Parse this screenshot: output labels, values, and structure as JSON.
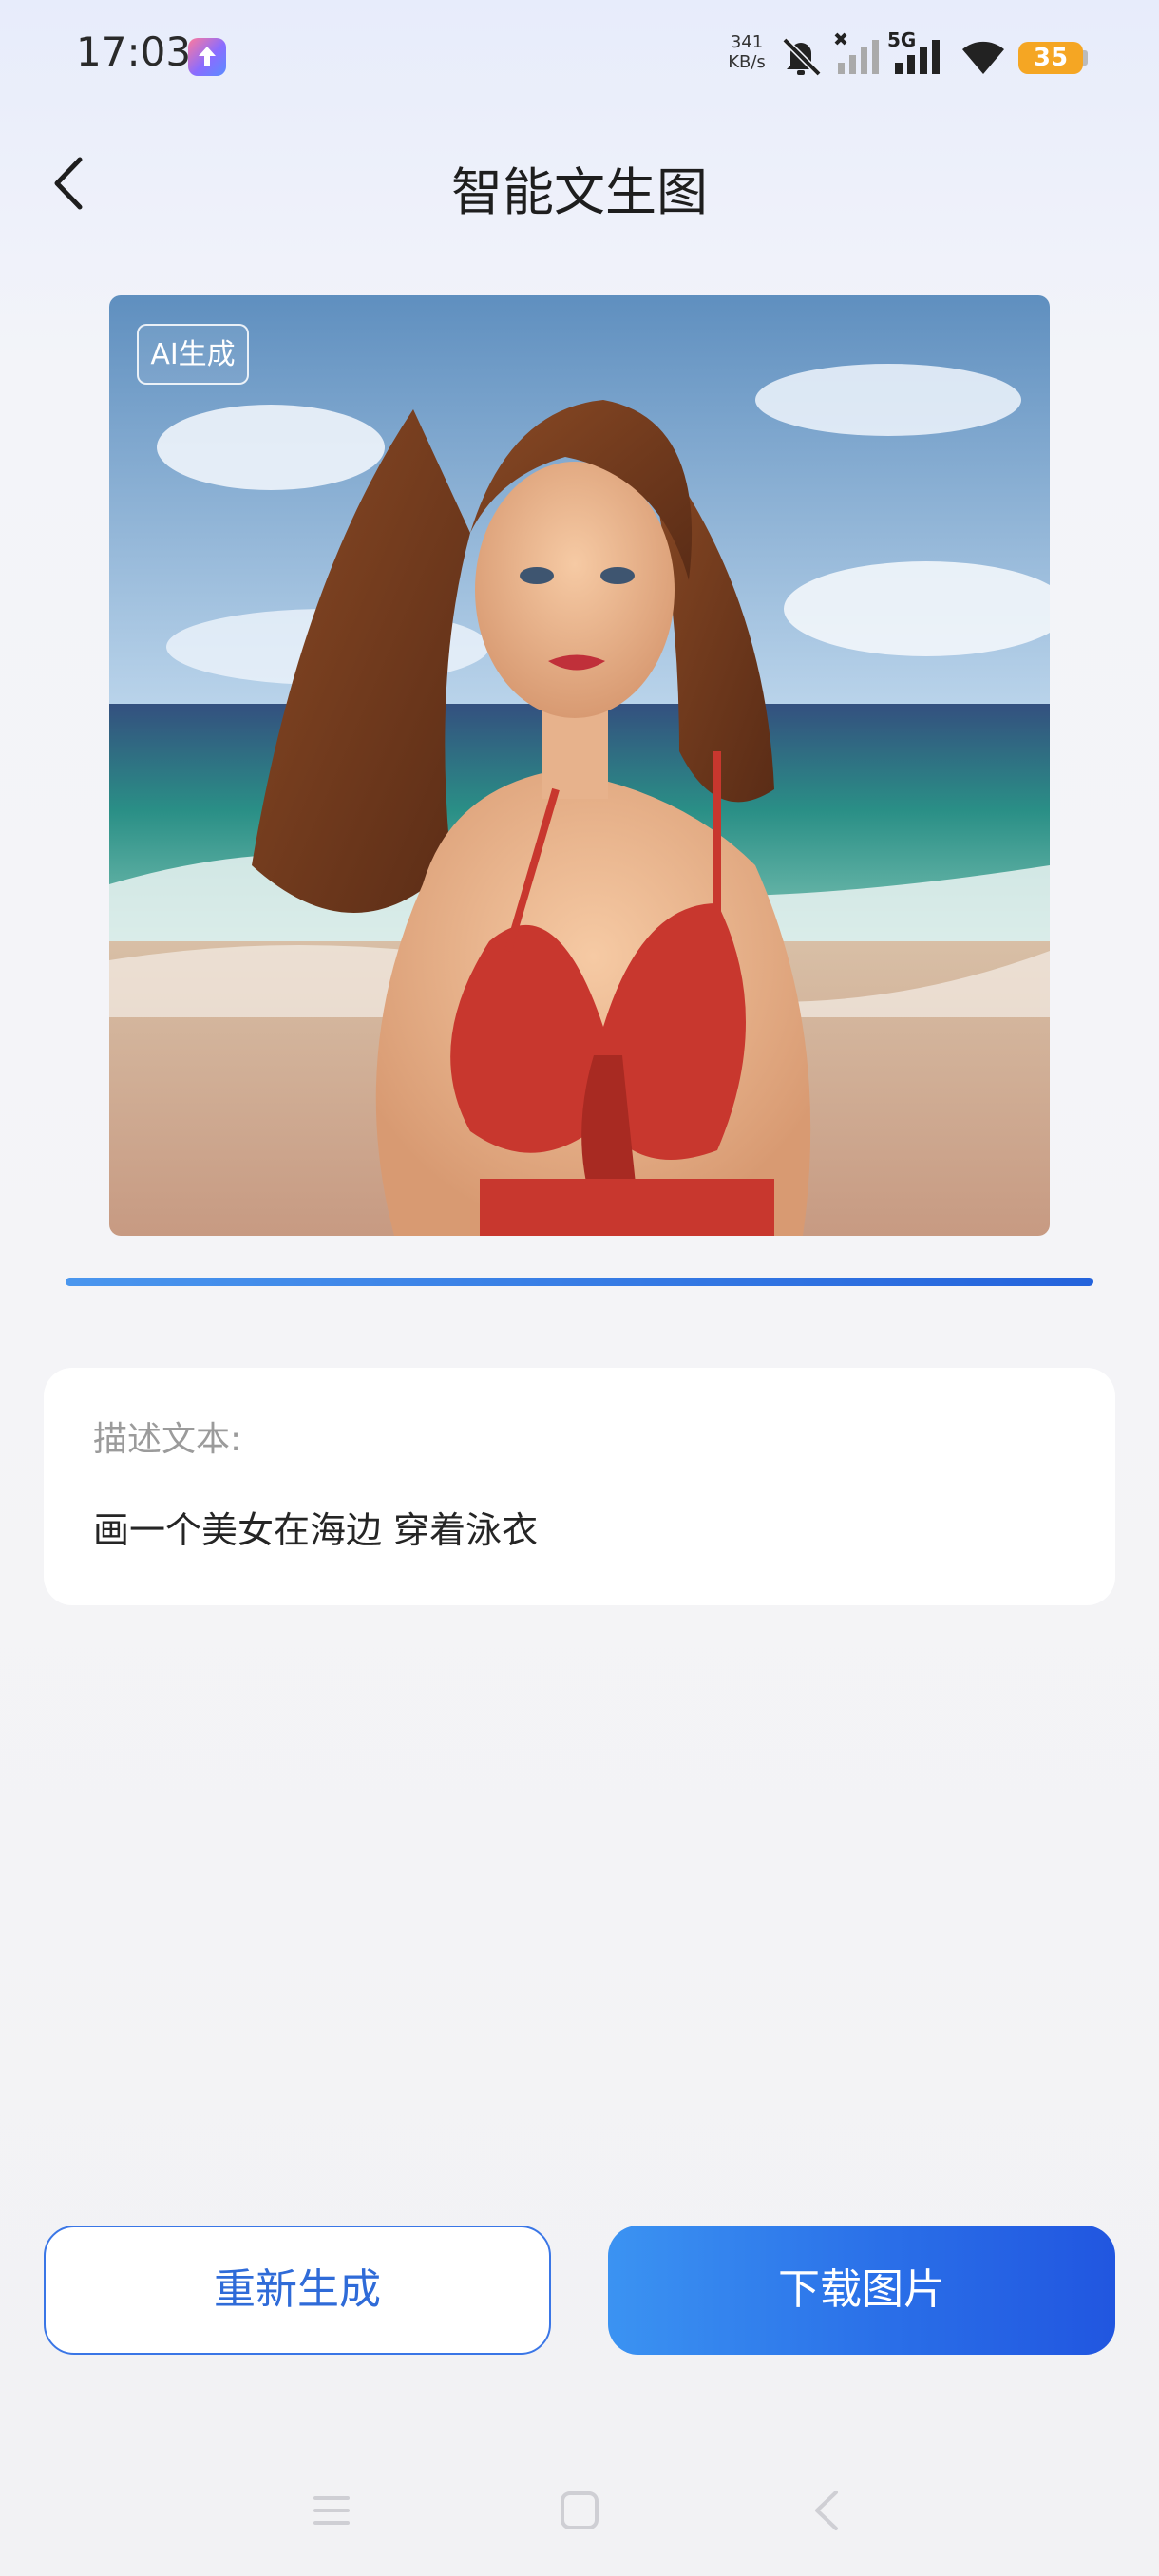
{
  "status_bar": {
    "time": "17:03",
    "net_speed_value": "341",
    "net_speed_unit": "KB/s",
    "network_type": "5G",
    "battery": "35",
    "icons": [
      "app-notification-icon",
      "mute-icon",
      "signal-no-sim-icon",
      "signal-5g-icon",
      "wifi-icon",
      "battery-icon"
    ]
  },
  "header": {
    "title": "智能文生图",
    "back_icon": "chevron-left-icon"
  },
  "image": {
    "tag": "AI生成",
    "alt": "AI generated illustration"
  },
  "progress": {
    "value": 1.0
  },
  "description": {
    "label": "描述文本:",
    "text": "画一个美女在海边 穿着泳衣"
  },
  "actions": {
    "regenerate_label": "重新生成",
    "download_label": "下载图片"
  },
  "nav": {
    "icons": [
      "menu-icon",
      "home-icon",
      "back-icon"
    ]
  },
  "colors": {
    "accent": "#2f6bd8",
    "battery": "#f5a623",
    "progress": "#2463dc"
  }
}
